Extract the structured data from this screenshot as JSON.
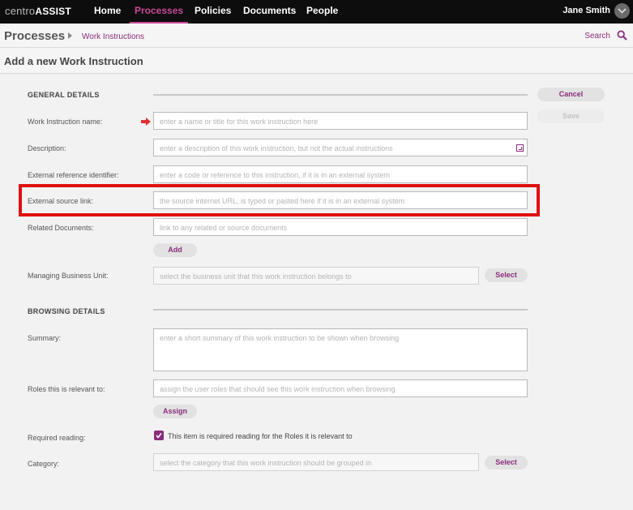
{
  "nav": {
    "logo_part1": "centro",
    "logo_part2": "ASSIST",
    "items": [
      {
        "label": "Home"
      },
      {
        "label": "Processes"
      },
      {
        "label": "Policies"
      },
      {
        "label": "Documents"
      },
      {
        "label": "People"
      }
    ],
    "active_item": "Processes",
    "user_name": "Jane Smith",
    "accent_color": "#c84a9a"
  },
  "breadcrumb": {
    "root": "Processes",
    "current": "Work Instructions",
    "search_label": "Search"
  },
  "page": {
    "title": "Add a new Work Instruction"
  },
  "actions": {
    "cancel": "Cancel",
    "save": "Save"
  },
  "general": {
    "heading": "GENERAL DETAILS",
    "name": {
      "label": "Work Instruction name:",
      "placeholder": "enter a name or title for this work instruction here",
      "required": true
    },
    "description": {
      "label": "Description:",
      "placeholder": "enter a description of this work instruction, but not the actual instructions"
    },
    "ext_ref": {
      "label": "External reference identifier:",
      "placeholder": "enter a code or reference to this instruction, if it is in an external system"
    },
    "ext_link": {
      "label": "External source link:",
      "placeholder": "the source internet URL, is typed or pasted here if it is in an external system",
      "highlighted": true
    },
    "related_docs": {
      "label": "Related Documents:",
      "placeholder": "link to any related or source documents",
      "button": "Add"
    },
    "business_unit": {
      "label": "Managing Business Unit:",
      "placeholder": "select the business unit that this work instruction belongs to",
      "button": "Select"
    }
  },
  "browsing": {
    "heading": "BROWSING DETAILS",
    "summary": {
      "label": "Summary:",
      "placeholder": "enter a short summary of this work instruction to be shown when browsing"
    },
    "roles": {
      "label": "Roles this is relevant to:",
      "placeholder": "assign the user roles that should see this work instruction when browsing",
      "button": "Assign"
    },
    "required_reading": {
      "label": "Required reading:",
      "checkbox_text": "This item is required reading for the Roles it is relevant to",
      "checked": true
    },
    "category": {
      "label": "Category:",
      "placeholder": "select the category that this work instruction should be grouped in",
      "button": "Select"
    }
  }
}
